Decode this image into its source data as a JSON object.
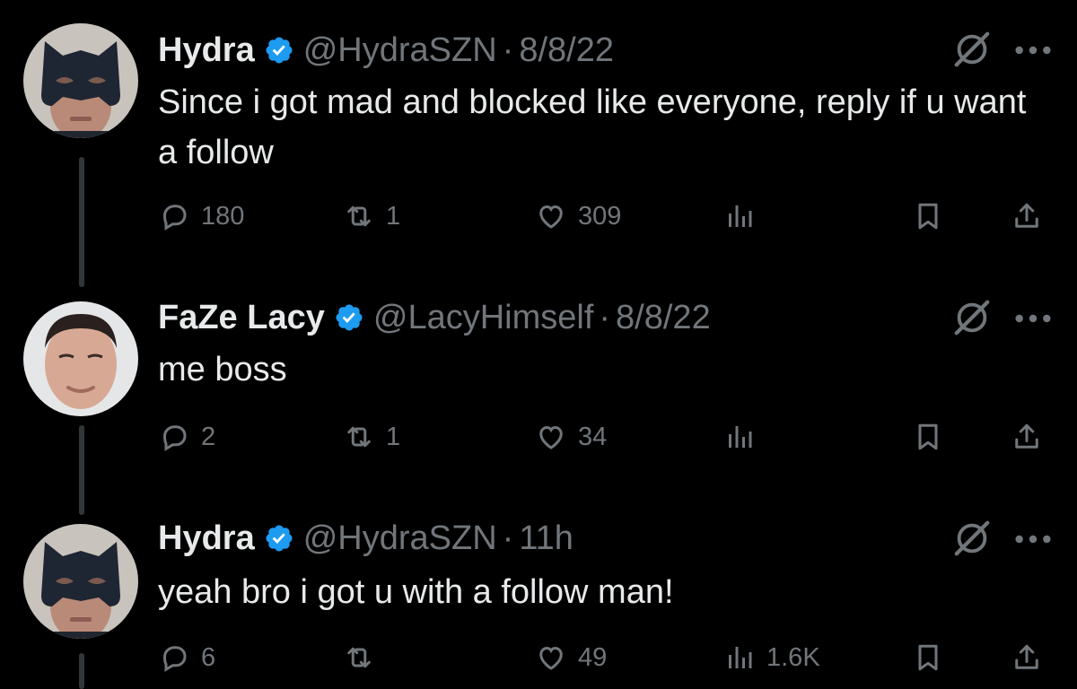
{
  "tweets": [
    {
      "name": "Hydra",
      "handle": "@HydraSZN",
      "separator": "·",
      "time": "8/8/22",
      "text": "Since i got mad and blocked like everyone, reply if u want a follow",
      "counts": {
        "replies": "180",
        "reposts": "1",
        "likes": "309",
        "views": ""
      },
      "avatar": "batman-mask-avatar"
    },
    {
      "name": "FaZe Lacy",
      "handle": "@LacyHimself",
      "separator": "·",
      "time": "8/8/22",
      "text": "me boss",
      "counts": {
        "replies": "2",
        "reposts": "1",
        "likes": "34",
        "views": ""
      },
      "avatar": "face-photo-avatar"
    },
    {
      "name": "Hydra",
      "handle": "@HydraSZN",
      "separator": "·",
      "time": "11h",
      "text": "yeah bro i got u with a follow man!",
      "counts": {
        "replies": "6",
        "reposts": "",
        "likes": "49",
        "views": "1.6K"
      },
      "avatar": "batman-mask-avatar"
    }
  ],
  "icons": {
    "verified": "verified-badge-icon",
    "grok": "grok-icon",
    "more": "more-icon",
    "reply": "reply-icon",
    "repost": "repost-icon",
    "like": "like-icon",
    "views": "views-icon",
    "bookmark": "bookmark-icon",
    "share": "share-icon"
  },
  "colors": {
    "background": "#000000",
    "text": "#e7e9ea",
    "secondary": "#71767b",
    "verified": "#1d9bf0",
    "thread_line": "#333639"
  }
}
